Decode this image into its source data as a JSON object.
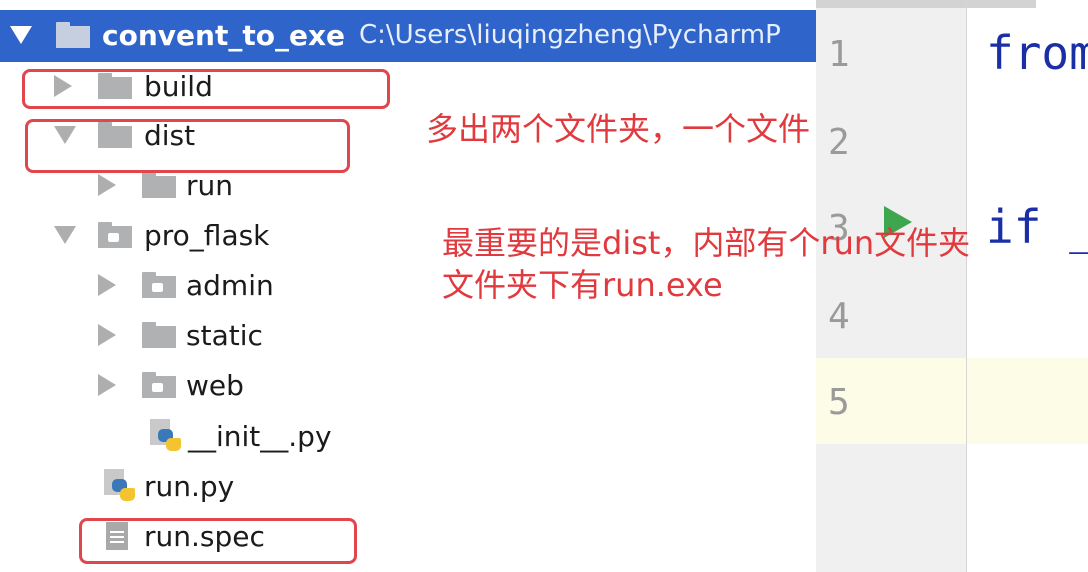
{
  "project_tree": {
    "root": {
      "name": "convent_to_exe",
      "path": "C:\\Users\\liuqingzheng\\PycharmP"
    },
    "items": [
      {
        "label": "build"
      },
      {
        "label": "dist"
      },
      {
        "label": "run"
      },
      {
        "label": "pro_flask"
      },
      {
        "label": "admin"
      },
      {
        "label": "static"
      },
      {
        "label": "web"
      },
      {
        "label": "__init__.py"
      },
      {
        "label": "run.py"
      },
      {
        "label": "run.spec"
      }
    ]
  },
  "editor": {
    "line_numbers": [
      "1",
      "2",
      "3",
      "4",
      "5"
    ],
    "code_lines": [
      "from",
      "if __"
    ]
  },
  "annotations": {
    "note1": "多出两个文件夹，一个文件",
    "note2_line1": "最重要的是dist，内部有个run文件夹",
    "note2_line2": "文件夹下有run.exe",
    "color": "#e0393e"
  }
}
